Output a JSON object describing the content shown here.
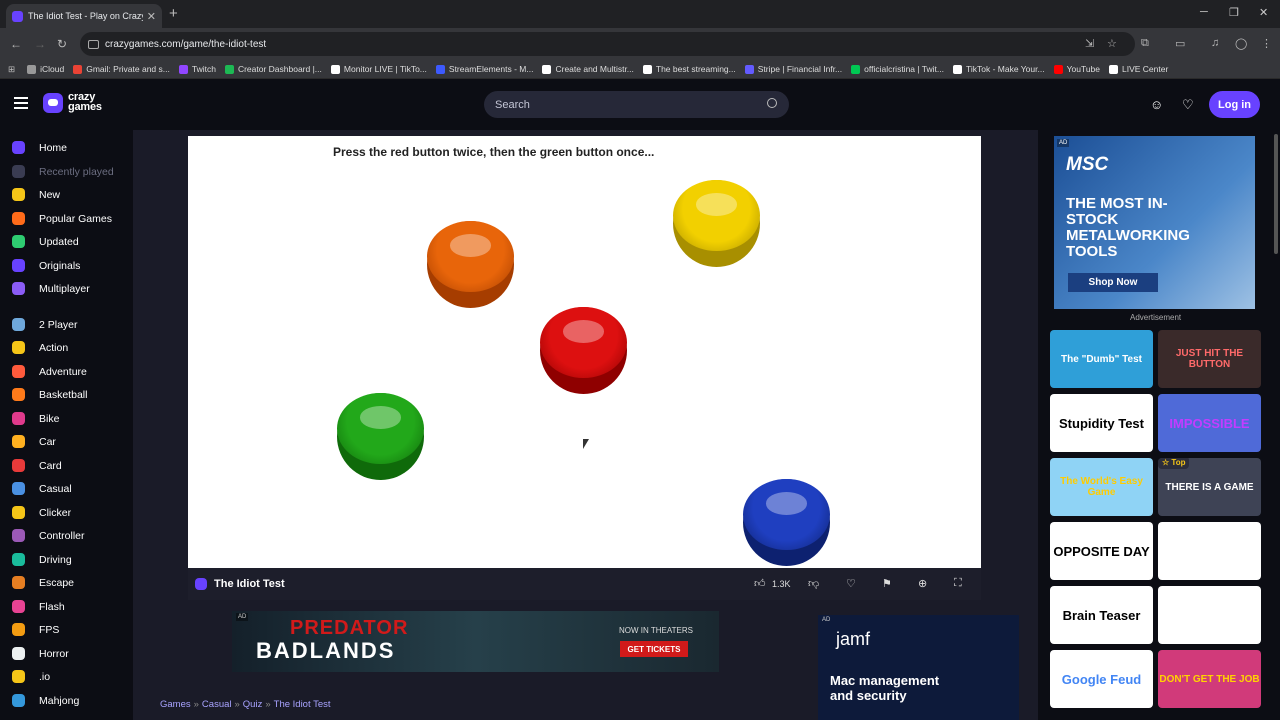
{
  "browser": {
    "tab_title": "The Idiot Test",
    "tab_subtitle": "Play on Crazy",
    "url": "crazygames.com/game/the-idiot-test",
    "new_tab_symbol": "+",
    "bookmarks": [
      {
        "label": "iCloud",
        "color": "#999999"
      },
      {
        "label": "Gmail: Private and s...",
        "color": "#ea4335"
      },
      {
        "label": "Twitch",
        "color": "#9146ff"
      },
      {
        "label": "Creator Dashboard |...",
        "color": "#1db954"
      },
      {
        "label": "Monitor LIVE | TikTo...",
        "color": "#ffffff"
      },
      {
        "label": "StreamElements - M...",
        "color": "#3d5afe"
      },
      {
        "label": "Create and Multistr...",
        "color": "#ffffff"
      },
      {
        "label": "The best streaming...",
        "color": "#ffffff"
      },
      {
        "label": "Stripe | Financial Infr...",
        "color": "#635bff"
      },
      {
        "label": "officialcristina | Twit...",
        "color": "#00c853"
      },
      {
        "label": "TikTok - Make Your...",
        "color": "#ffffff"
      },
      {
        "label": "YouTube",
        "color": "#ff0000"
      },
      {
        "label": "LIVE Center",
        "color": "#ffffff"
      }
    ]
  },
  "header": {
    "logo_line1": "crazy",
    "logo_line2": "games",
    "search_placeholder": "Search",
    "login_label": "Log in"
  },
  "sidebar": {
    "items": [
      {
        "label": "Home",
        "color": "#6842ff",
        "dim": false
      },
      {
        "label": "Recently played",
        "color": "#3a3c52",
        "dim": true
      },
      {
        "label": "New",
        "color": "#f5c518",
        "dim": false
      },
      {
        "label": "Popular Games",
        "color": "#ff6b1a",
        "dim": false
      },
      {
        "label": "Updated",
        "color": "#2ecc71",
        "dim": false
      },
      {
        "label": "Originals",
        "color": "#6842ff",
        "dim": false
      },
      {
        "label": "Multiplayer",
        "color": "#8b5cf6",
        "dim": false
      },
      {
        "label": "2 Player",
        "color": "#6fa8dc",
        "dim": false
      },
      {
        "label": "Action",
        "color": "#f5c518",
        "dim": false
      },
      {
        "label": "Adventure",
        "color": "#ff5a3c",
        "dim": false
      },
      {
        "label": "Basketball",
        "color": "#ff7a1a",
        "dim": false
      },
      {
        "label": "Bike",
        "color": "#e03a8c",
        "dim": false
      },
      {
        "label": "Car",
        "color": "#ffb020",
        "dim": false
      },
      {
        "label": "Card",
        "color": "#e83a3a",
        "dim": false
      },
      {
        "label": "Casual",
        "color": "#4a90e2",
        "dim": false
      },
      {
        "label": "Clicker",
        "color": "#f5c518",
        "dim": false
      },
      {
        "label": "Controller",
        "color": "#9b59b6",
        "dim": false
      },
      {
        "label": "Driving",
        "color": "#1abc9c",
        "dim": false
      },
      {
        "label": "Escape",
        "color": "#e67e22",
        "dim": false
      },
      {
        "label": "Flash",
        "color": "#e84393",
        "dim": false
      },
      {
        "label": "FPS",
        "color": "#f39c12",
        "dim": false
      },
      {
        "label": "Horror",
        "color": "#ecf0f1",
        "dim": false
      },
      {
        "label": ".io",
        "color": "#f5c518",
        "dim": false
      },
      {
        "label": "Mahjong",
        "color": "#3498db",
        "dim": false
      }
    ]
  },
  "game": {
    "instruction": "Press the red button twice, then the green button once...",
    "title": "The Idiot Test",
    "likes": "1.3K",
    "buttons": [
      {
        "name": "orange",
        "color": "#e8650a",
        "dark": "#a63d00"
      },
      {
        "name": "yellow",
        "color": "#f2d000",
        "dark": "#a88f00"
      },
      {
        "name": "red",
        "color": "#dd1010",
        "dark": "#8f0000"
      },
      {
        "name": "green",
        "color": "#22a81a",
        "dark": "#0f6a0a"
      },
      {
        "name": "blue",
        "color": "#1f3fc0",
        "dark": "#0d2170"
      }
    ]
  },
  "ads": {
    "ad_marker": "AD",
    "predator_line1": "PREDATOR",
    "predator_line2": "BADLANDS",
    "predator_theaters": "NOW IN THEATERS",
    "predator_cta": "GET TICKETS",
    "jamf_logo": "jamf",
    "jamf_text": "Mac management and security",
    "msc_logo": "MSC",
    "msc_text": "THE MOST IN-STOCK METALWORKING TOOLS",
    "msc_cta": "Shop Now",
    "advertisement_label": "Advertisement"
  },
  "breadcrumb": [
    "Games",
    "Casual",
    "Quiz",
    "The Idiot Test"
  ],
  "breadcrumb_separator": "»",
  "recommended": [
    {
      "label": "The \"Dumb\" Test",
      "bg": "#2f9fd8",
      "fg": "#ffffff"
    },
    {
      "label": "JUST HIT THE BUTTON",
      "bg": "#3a2a2a",
      "fg": "#ff6a6a"
    },
    {
      "label": "Stupidity Test",
      "bg": "#ffffff",
      "fg": "#000000"
    },
    {
      "label": "IMPOSSIBLE",
      "bg": "#4f6ad8",
      "fg": "#c33cff"
    },
    {
      "label": "The World's Easy Game",
      "bg": "#8fd3f5",
      "fg": "#ffcc00"
    },
    {
      "label": "THERE IS A GAME",
      "bg": "#3e4355",
      "fg": "#ffffff"
    },
    {
      "label": "OPPOSITE DAY",
      "bg": "#ffffff",
      "fg": "#000000"
    },
    {
      "label": "",
      "bg": "#ffffff",
      "fg": "#000000"
    },
    {
      "label": "Brain Teaser",
      "bg": "#ffffff",
      "fg": "#000000"
    },
    {
      "label": "",
      "bg": "#ffffff",
      "fg": "#1f3fc0"
    },
    {
      "label": "Google Feud",
      "bg": "#ffffff",
      "fg": "#4285f4"
    },
    {
      "label": "DON'T GET THE JOB",
      "bg": "#d13a7a",
      "fg": "#ffd400"
    }
  ],
  "top_badge": "Top"
}
